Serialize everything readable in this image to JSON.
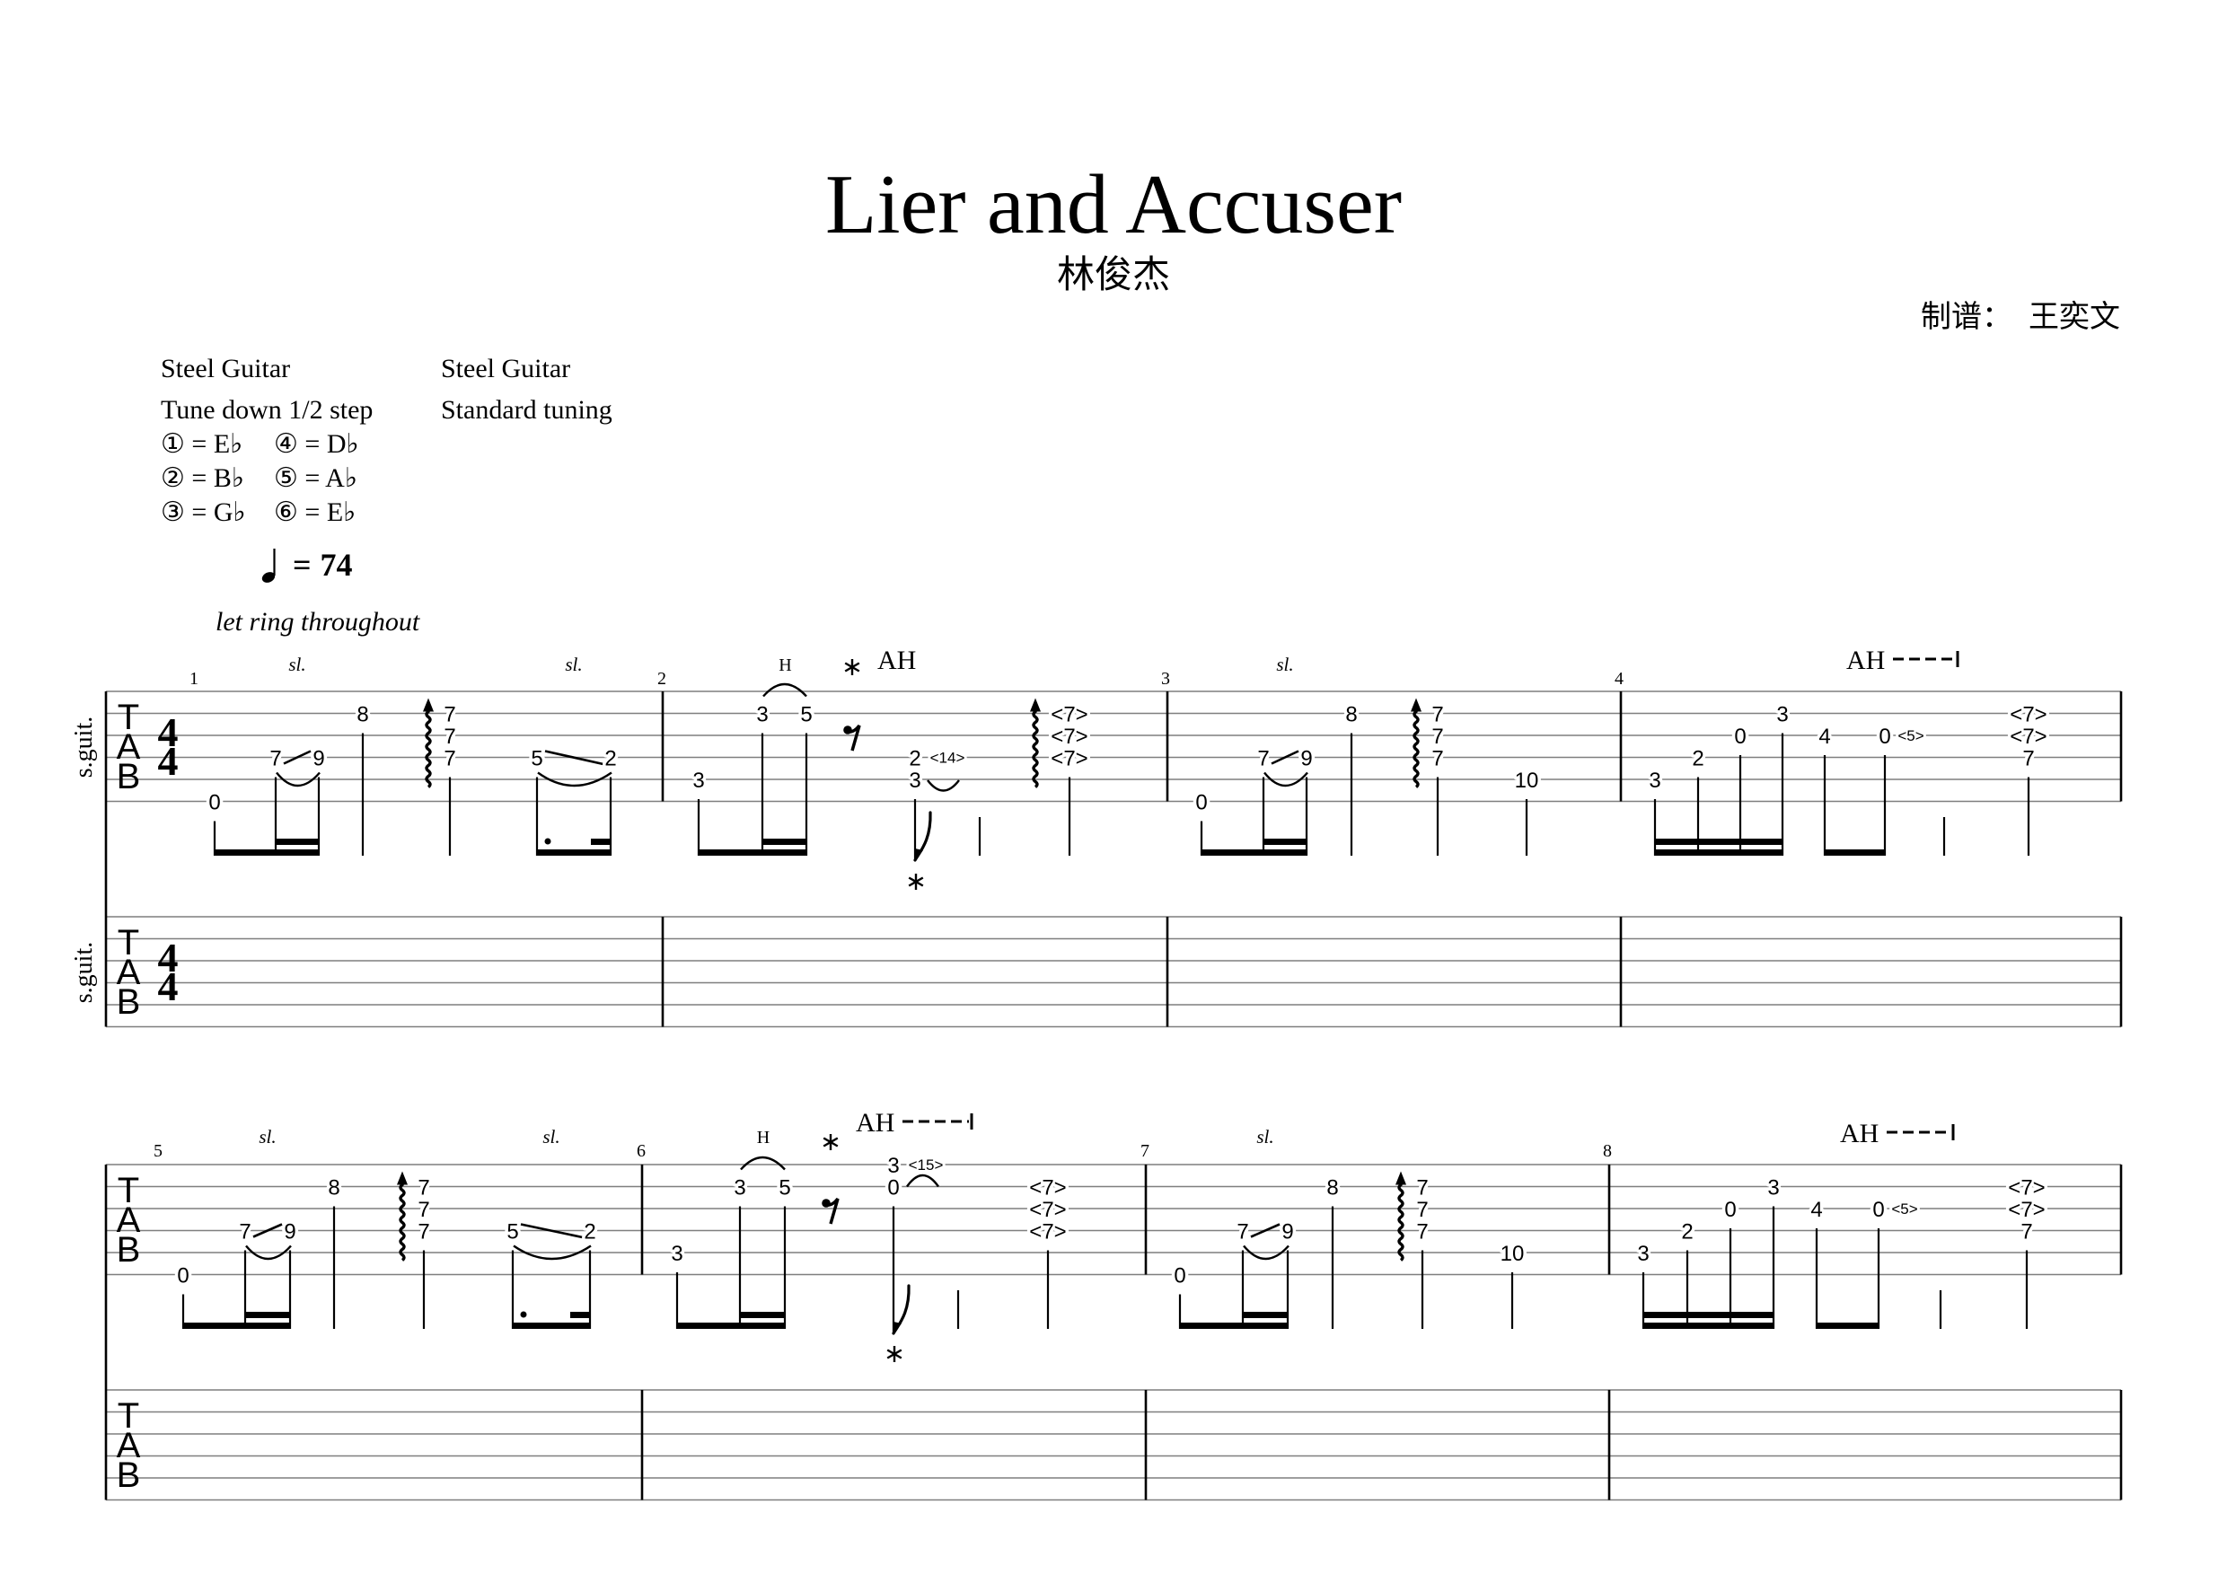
{
  "header": {
    "title": "Lier and Accuser",
    "artist": "林俊杰",
    "transcriber_label": "制谱：",
    "transcriber": "王奕文"
  },
  "tracks": [
    {
      "name": "Steel Guitar",
      "tuning": "Tune down 1/2 step",
      "strings": [
        {
          "string": 1,
          "label": "① = E♭"
        },
        {
          "string": 2,
          "label": "② = B♭"
        },
        {
          "string": 3,
          "label": "③ = G♭"
        },
        {
          "string": 4,
          "label": "④ = D♭"
        },
        {
          "string": 5,
          "label": "⑤ = A♭"
        },
        {
          "string": 6,
          "label": "⑥ = E♭"
        }
      ]
    },
    {
      "name": "Steel Guitar",
      "tuning": "Standard tuning"
    }
  ],
  "tempo": {
    "note": "quarter",
    "equals": "=",
    "bpm": "74"
  },
  "performance_note": "let ring throughout",
  "staff": {
    "clef": [
      "T",
      "A",
      "B"
    ],
    "time_signature": {
      "top": "4",
      "bottom": "4"
    },
    "track_label": "s.guit."
  },
  "labels": {
    "slide": "sl.",
    "hammer": "H"
  },
  "systems": [
    {
      "measures": [
        "1",
        "2",
        "3",
        "4"
      ],
      "show_time_signature": true,
      "show_track_label": true
    },
    {
      "measures": [
        "5",
        "6",
        "7",
        "8"
      ],
      "show_time_signature": false,
      "show_track_label": false
    }
  ],
  "measures": [
    {
      "number": "1",
      "events": [
        {
          "dur": "8th",
          "notes": [
            {
              "string": 6,
              "fret": "0"
            }
          ]
        },
        {
          "dur": "16th",
          "notes": [
            {
              "string": 4,
              "fret": "7"
            }
          ],
          "slide_to_next": true
        },
        {
          "dur": "16th",
          "notes": [
            {
              "string": 4,
              "fret": "9"
            }
          ]
        },
        {
          "dur": "quarter",
          "notes": [
            {
              "string": 2,
              "fret": "8"
            }
          ]
        },
        {
          "dur": "quarter",
          "arpeggio": "up",
          "notes": [
            {
              "string": 2,
              "fret": "7"
            },
            {
              "string": 3,
              "fret": "7"
            },
            {
              "string": 4,
              "fret": "7"
            }
          ]
        },
        {
          "dur": "dotted-8th",
          "notes": [
            {
              "string": 4,
              "fret": "5"
            }
          ],
          "slide_to_next": true
        },
        {
          "dur": "16th",
          "notes": [
            {
              "string": 4,
              "fret": "2"
            }
          ]
        }
      ],
      "beam_groups": [
        [
          0,
          1,
          2
        ],
        [
          5,
          6
        ]
      ]
    },
    {
      "number": "2",
      "annotation": {
        "text": "AH",
        "extends": false,
        "marker": "*"
      },
      "events": [
        {
          "dur": "8th",
          "notes": [
            {
              "string": 5,
              "fret": "3"
            }
          ]
        },
        {
          "dur": "16th",
          "notes": [
            {
              "string": 2,
              "fret": "3"
            }
          ],
          "hammer_to_next": true
        },
        {
          "dur": "16th",
          "notes": [
            {
              "string": 2,
              "fret": "5"
            }
          ]
        },
        {
          "dur": "8th",
          "rest": true
        },
        {
          "dur": "8th",
          "marker_below": "*",
          "notes": [
            {
              "string": 4,
              "fret": "2",
              "harmonic": "<14>"
            },
            {
              "string": 5,
              "fret": "3",
              "tie": "below"
            }
          ]
        },
        {
          "dur": "quarter",
          "stem_only": true
        },
        {
          "dur": "quarter",
          "arpeggio": "up",
          "notes": [
            {
              "string": 2,
              "fret": "<7>"
            },
            {
              "string": 3,
              "fret": "<7>"
            },
            {
              "string": 4,
              "fret": "<7>"
            }
          ]
        }
      ],
      "beam_groups": [
        [
          0,
          1,
          2
        ]
      ]
    },
    {
      "number": "3",
      "events": [
        {
          "dur": "8th",
          "notes": [
            {
              "string": 6,
              "fret": "0"
            }
          ]
        },
        {
          "dur": "16th",
          "notes": [
            {
              "string": 4,
              "fret": "7"
            }
          ],
          "slide_to_next": true
        },
        {
          "dur": "16th",
          "notes": [
            {
              "string": 4,
              "fret": "9"
            }
          ]
        },
        {
          "dur": "quarter",
          "notes": [
            {
              "string": 2,
              "fret": "8"
            }
          ]
        },
        {
          "dur": "quarter",
          "arpeggio": "up",
          "notes": [
            {
              "string": 2,
              "fret": "7"
            },
            {
              "string": 3,
              "fret": "7"
            },
            {
              "string": 4,
              "fret": "7"
            }
          ]
        },
        {
          "dur": "quarter",
          "notes": [
            {
              "string": 5,
              "fret": "10"
            }
          ]
        }
      ],
      "beam_groups": [
        [
          0,
          1,
          2
        ]
      ]
    },
    {
      "number": "4",
      "annotation": {
        "text": "AH",
        "extends": true
      },
      "events": [
        {
          "dur": "16th",
          "notes": [
            {
              "string": 5,
              "fret": "3"
            }
          ]
        },
        {
          "dur": "16th",
          "notes": [
            {
              "string": 4,
              "fret": "2"
            }
          ]
        },
        {
          "dur": "16th",
          "notes": [
            {
              "string": 3,
              "fret": "0"
            }
          ]
        },
        {
          "dur": "16th",
          "notes": [
            {
              "string": 2,
              "fret": "3"
            }
          ]
        },
        {
          "dur": "8th",
          "notes": [
            {
              "string": 3,
              "fret": "4"
            }
          ]
        },
        {
          "dur": "8th",
          "notes": [
            {
              "string": 3,
              "fret": "0",
              "harmonic": "<5>"
            }
          ]
        },
        {
          "dur": "quarter",
          "stem_only": true
        },
        {
          "dur": "quarter",
          "notes": [
            {
              "string": 2,
              "fret": "<7>"
            },
            {
              "string": 3,
              "fret": "<7>"
            },
            {
              "string": 4,
              "fret": "7"
            }
          ]
        }
      ],
      "beam_groups": [
        [
          0,
          1,
          2,
          3
        ],
        [
          4,
          5
        ]
      ]
    },
    {
      "number": "5",
      "events": [
        {
          "dur": "8th",
          "notes": [
            {
              "string": 6,
              "fret": "0"
            }
          ]
        },
        {
          "dur": "16th",
          "notes": [
            {
              "string": 4,
              "fret": "7"
            }
          ],
          "slide_to_next": true
        },
        {
          "dur": "16th",
          "notes": [
            {
              "string": 4,
              "fret": "9"
            }
          ]
        },
        {
          "dur": "quarter",
          "notes": [
            {
              "string": 2,
              "fret": "8"
            }
          ]
        },
        {
          "dur": "quarter",
          "arpeggio": "up",
          "notes": [
            {
              "string": 2,
              "fret": "7"
            },
            {
              "string": 3,
              "fret": "7"
            },
            {
              "string": 4,
              "fret": "7"
            }
          ]
        },
        {
          "dur": "dotted-8th",
          "notes": [
            {
              "string": 4,
              "fret": "5"
            }
          ],
          "slide_to_next": true
        },
        {
          "dur": "16th",
          "notes": [
            {
              "string": 4,
              "fret": "2"
            }
          ]
        }
      ],
      "beam_groups": [
        [
          0,
          1,
          2
        ],
        [
          5,
          6
        ]
      ]
    },
    {
      "number": "6",
      "annotation": {
        "text": "AH",
        "extends": true,
        "marker": "*"
      },
      "events": [
        {
          "dur": "8th",
          "notes": [
            {
              "string": 5,
              "fret": "3"
            }
          ]
        },
        {
          "dur": "16th",
          "notes": [
            {
              "string": 2,
              "fret": "3"
            }
          ],
          "hammer_to_next": true
        },
        {
          "dur": "16th",
          "notes": [
            {
              "string": 2,
              "fret": "5"
            }
          ]
        },
        {
          "dur": "8th",
          "rest": true
        },
        {
          "dur": "8th",
          "marker_below": "*",
          "notes": [
            {
              "string": 1,
              "fret": "3",
              "harmonic": "<15>"
            },
            {
              "string": 2,
              "fret": "0",
              "tie": "above"
            }
          ]
        },
        {
          "dur": "quarter",
          "stem_only": true
        },
        {
          "dur": "quarter",
          "notes": [
            {
              "string": 2,
              "fret": "<7>"
            },
            {
              "string": 3,
              "fret": "<7>"
            },
            {
              "string": 4,
              "fret": "<7>"
            }
          ]
        }
      ],
      "beam_groups": [
        [
          0,
          1,
          2
        ]
      ]
    },
    {
      "number": "7",
      "events": [
        {
          "dur": "8th",
          "notes": [
            {
              "string": 6,
              "fret": "0"
            }
          ]
        },
        {
          "dur": "16th",
          "notes": [
            {
              "string": 4,
              "fret": "7"
            }
          ],
          "slide_to_next": true
        },
        {
          "dur": "16th",
          "notes": [
            {
              "string": 4,
              "fret": "9"
            }
          ]
        },
        {
          "dur": "quarter",
          "notes": [
            {
              "string": 2,
              "fret": "8"
            }
          ]
        },
        {
          "dur": "quarter",
          "arpeggio": "up",
          "notes": [
            {
              "string": 2,
              "fret": "7"
            },
            {
              "string": 3,
              "fret": "7"
            },
            {
              "string": 4,
              "fret": "7"
            }
          ]
        },
        {
          "dur": "quarter",
          "notes": [
            {
              "string": 5,
              "fret": "10"
            }
          ]
        }
      ],
      "beam_groups": [
        [
          0,
          1,
          2
        ]
      ]
    },
    {
      "number": "8",
      "annotation": {
        "text": "AH",
        "extends": true
      },
      "events": [
        {
          "dur": "16th",
          "notes": [
            {
              "string": 5,
              "fret": "3"
            }
          ]
        },
        {
          "dur": "16th",
          "notes": [
            {
              "string": 4,
              "fret": "2"
            }
          ]
        },
        {
          "dur": "16th",
          "notes": [
            {
              "string": 3,
              "fret": "0"
            }
          ]
        },
        {
          "dur": "16th",
          "notes": [
            {
              "string": 2,
              "fret": "3"
            }
          ]
        },
        {
          "dur": "8th",
          "notes": [
            {
              "string": 3,
              "fret": "4"
            }
          ]
        },
        {
          "dur": "8th",
          "notes": [
            {
              "string": 3,
              "fret": "0",
              "harmonic": "<5>"
            }
          ]
        },
        {
          "dur": "quarter",
          "stem_only": true
        },
        {
          "dur": "quarter",
          "notes": [
            {
              "string": 2,
              "fret": "<7>"
            },
            {
              "string": 3,
              "fret": "<7>"
            },
            {
              "string": 4,
              "fret": "7"
            }
          ]
        }
      ],
      "beam_groups": [
        [
          0,
          1,
          2,
          3
        ],
        [
          4,
          5
        ]
      ]
    }
  ]
}
